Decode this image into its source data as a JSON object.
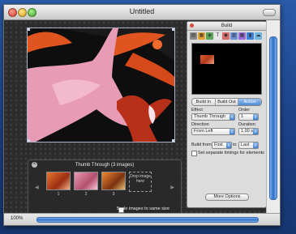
{
  "window": {
    "title": "Untitled"
  },
  "inspector": {
    "title": "Build",
    "tabs": [
      "Build In",
      "Build Out",
      "Action"
    ],
    "active_tab": "Action",
    "effect_label": "Effect",
    "effect_value": "Thumb Through",
    "order_label": "Order",
    "order_value": "1",
    "direction_label": "Direction",
    "direction_value": "From Left",
    "duration_label": "Duration",
    "duration_value": "1.00 s",
    "build_from_label": "Build from",
    "build_from_value": "First",
    "to_label": "to",
    "to_value": "Last",
    "separate_timings_label": "Set separate timings for elements",
    "more_options_label": "More Options"
  },
  "thumb_panel": {
    "title": "Thumb Through (3 images)",
    "thumbs": [
      {
        "num": "1"
      },
      {
        "num": "2"
      },
      {
        "num": "3"
      }
    ],
    "drop_label": "Drop image here",
    "scale_label": "Scale images to same size"
  },
  "status": {
    "zoom": "100%"
  },
  "colors": {
    "accent": "#3f7fd2",
    "canvas": "#2c2c2c",
    "starfish_pink": "#e79bb4",
    "starfish_orange": "#e0551f"
  }
}
